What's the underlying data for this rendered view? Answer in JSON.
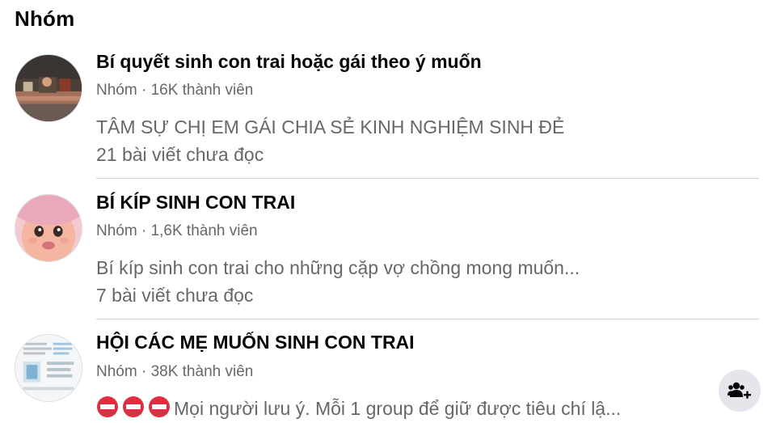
{
  "section": {
    "title": "Nhóm"
  },
  "groups": [
    {
      "name": "Bí quyết sinh con trai hoặc gái theo ý muốn",
      "meta": "Nhóm · 16K thành viên",
      "description": "TÂM SỰ CHỊ EM GÁI CHIA SẺ KINH NGHIỆM SINH ĐẺ",
      "unread": "21 bài viết chưa đọc"
    },
    {
      "name": "BÍ KÍP SINH CON TRAI",
      "meta": "Nhóm · 1,6K thành viên",
      "description": "Bí kíp sinh con trai cho những cặp vợ chồng mong muốn...",
      "unread": "7 bài viết chưa đọc"
    },
    {
      "name": "HỘI CÁC MẸ MUỐN SINH CON TRAI",
      "meta": "Nhóm · 38K thành viên",
      "description": "Mọi người lưu ý. Mỗi 1 group để giữ được tiêu chí lậ...",
      "description_prefix_icons": [
        "no-entry-icon",
        "no-entry-icon",
        "no-entry-icon"
      ]
    }
  ],
  "actions": {
    "join_icon": "group-join-icon"
  },
  "colors": {
    "primary_text": "#050505",
    "secondary_text": "#65676b",
    "divider": "#ced0d4",
    "button_bg": "#e4e6eb",
    "stop_red": "#dd2e44"
  }
}
